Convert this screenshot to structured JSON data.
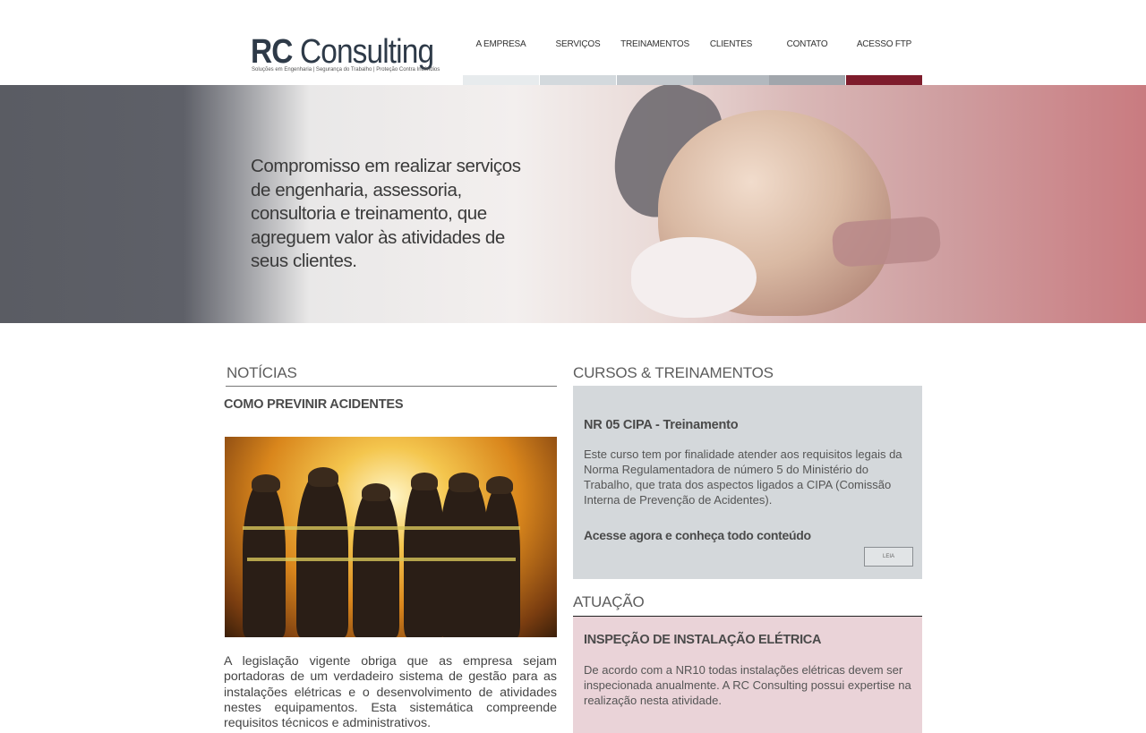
{
  "header": {
    "logo_rc": "RC",
    "logo_consulting": "Consulting",
    "logo_tagline": "Soluções em Engenharia | Segurança do Trabalho | Proteção Contra Incêndios"
  },
  "nav": {
    "items": [
      {
        "label": "A EMPRESA",
        "bar_color": "#e7ebed"
      },
      {
        "label": "SERVIÇOS",
        "bar_color": "#d3d9dd"
      },
      {
        "label": "TREINAMENTOS",
        "bar_color": "#c3c9ce"
      },
      {
        "label": "CLIENTES",
        "bar_color": "#b2b8be"
      },
      {
        "label": "CONTATO",
        "bar_color": "#a1a6ac"
      },
      {
        "label": "ACESSO FTP",
        "bar_color": "#7e1c2c"
      }
    ]
  },
  "hero": {
    "text": "Compromisso em realizar serviços de engenharia, assessoria, consultoria e treinamento, que agreguem valor às atividades de seus clientes."
  },
  "news": {
    "section_title": "NOTÍCIAS",
    "headline": "COMO PREVINIR ACIDENTES",
    "text": "A legislação vigente obriga que as empresa sejam portadoras de um verdadeiro sistema de gestão para as instalações elétricas e o desenvolvimento de atividades nestes equipamentos. Esta sistemática compreende requisitos técnicos e administrativos."
  },
  "courses": {
    "section_title": "CURSOS & TREINAMENTOS",
    "title": "NR 05 CIPA - Treinamento",
    "description": "Este curso tem por finalidade atender aos requisitos legais da Norma Regulamentadora de número 5 do Ministério do Trabalho, que trata dos aspectos ligados a CIPA (Comissão Interna de Prevenção de Acidentes).",
    "cta": "Acesse agora e conheça todo conteúdo",
    "button_label": "LEIA"
  },
  "atuacao": {
    "section_title": "ATUAÇÃO",
    "title": "INSPEÇÃO DE INSTALAÇÃO ELÉTRICA",
    "description": "De acordo com a NR10 todas instalações elétricas devem ser inspecionada anualmente. A RC Consulting possui expertise na realização nesta atividade."
  }
}
